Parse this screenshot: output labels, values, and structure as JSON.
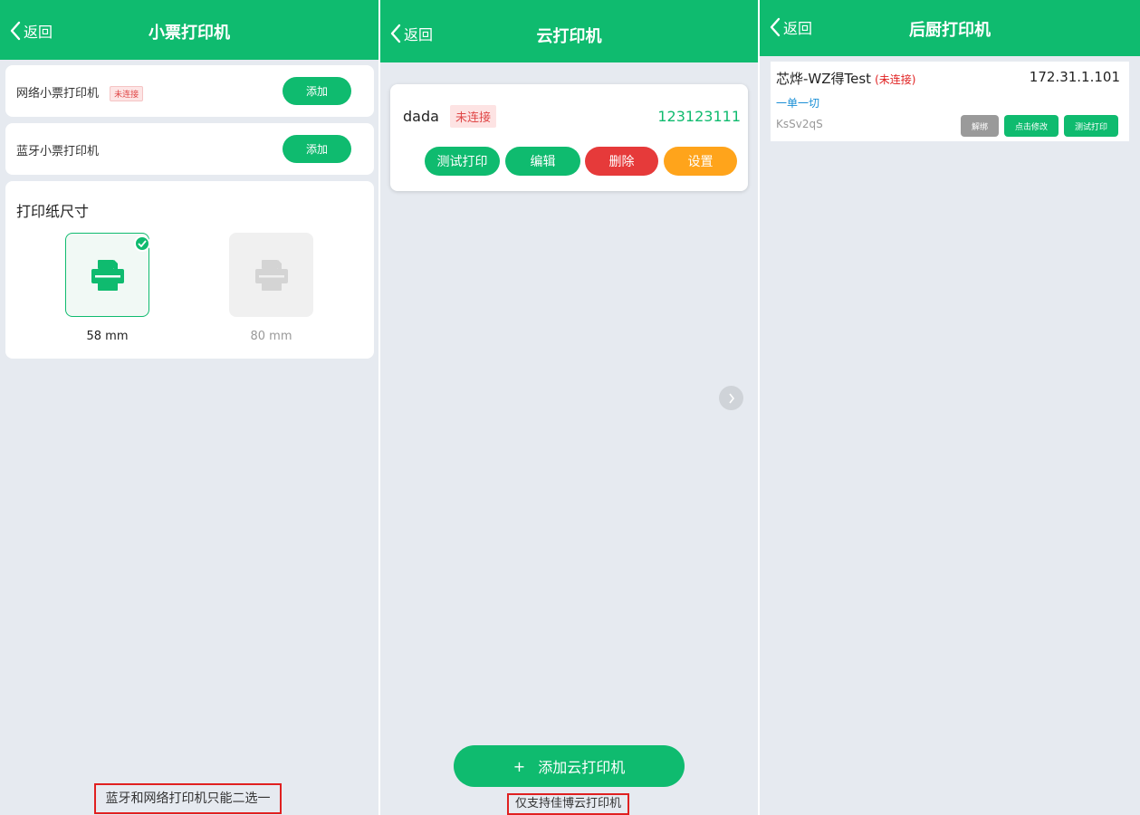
{
  "colors": {
    "brand": "#0fbb6f",
    "danger": "#e63a3a",
    "warning": "#ffa41b",
    "muted": "#999999"
  },
  "receipt_printer": {
    "back_label": "返回",
    "title": "小票打印机",
    "network_label": "网络小票打印机",
    "network_status": "未连接",
    "network_add": "添加",
    "bluetooth_label": "蓝牙小票打印机",
    "bluetooth_add": "添加",
    "paper_title": "打印纸尺寸",
    "paper_options": [
      {
        "label": "58 mm",
        "selected": true
      },
      {
        "label": "80 mm",
        "selected": false
      }
    ],
    "footnote": "蓝牙和网络打印机只能二选一"
  },
  "cloud_printer": {
    "back_label": "返回",
    "title": "云打印机",
    "printer": {
      "name": "dada",
      "status": "未连接",
      "id": "123123111",
      "actions": [
        "测试打印",
        "编辑",
        "删除",
        "设置"
      ]
    },
    "add_button": "添加云打印机",
    "add_icon": "+",
    "footnote": "仅支持佳博云打印机"
  },
  "kitchen_printer": {
    "back_label": "返回",
    "title": "后厨打印机",
    "printer": {
      "name": "芯烨-WZ得Test",
      "status": "(未连接)",
      "ip": "172.31.1.101",
      "mode": "一单一切",
      "code": "KsSv2qS",
      "actions": [
        "解绑",
        "点击修改",
        "测试打印"
      ]
    }
  }
}
